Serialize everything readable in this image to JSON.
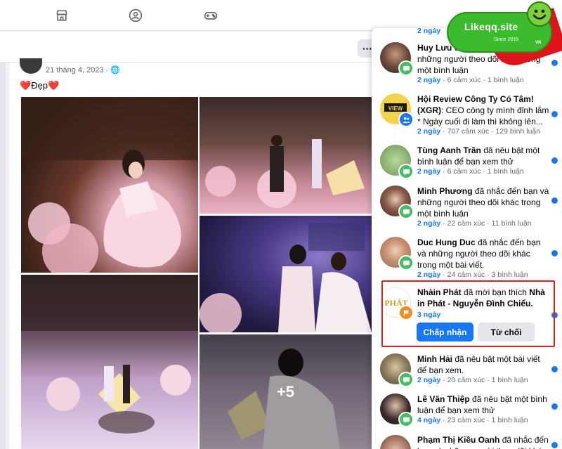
{
  "post": {
    "date": "21 tháng 4, 2023 ·",
    "caption_text": "Đẹp",
    "heart": "❤️",
    "more_label": "···",
    "more_photos": "+5"
  },
  "notifications": [
    {
      "text_tail": "2 ngày",
      "partial": true
    },
    {
      "name": "Huy Lưu",
      "action": "đã nhắc đến bạn và những người theo dõi khác trong một bình luận",
      "time": "2 ngày",
      "stats": "6 cảm xúc · 1 bình luận",
      "badge": "comment"
    },
    {
      "name": "Hội Review Công Ty Có Tâm! (XGR)",
      "action": ": CEO công ty mình đỉnh lắm * Ngày cuối đi làm thì không lên...",
      "time": "2 ngày",
      "stats": "707 cảm xúc · 129 bình luận",
      "badge": "group"
    },
    {
      "name": "Tùng Aanh Trần",
      "action": "đã nêu bật một bình luận để bạn xem thử",
      "time": "2 ngày",
      "stats": "6 cảm xúc · 1 bình luận",
      "badge": "comment"
    },
    {
      "name": "Minh Phương",
      "action": "đã nhắc đến bạn và những người theo dõi khác trong một bình luận",
      "time": "2 ngày",
      "stats": "22 cảm xúc · 11 bình luận",
      "badge": "comment"
    },
    {
      "name": "Duc Hung Duc",
      "action": "đã nhắc đến bạn và những người theo dõi khác trong một bài viết.",
      "time": "2 ngày",
      "stats": "24 cảm xúc · 3 bình luận",
      "badge": "comment"
    },
    {
      "name": "Nhàin Phát",
      "action": "đã mời bạn thích",
      "target": "Nhà in Phát - Nguyễn Đình Chiểu.",
      "time": "3 ngày",
      "badge": "page",
      "accept": "Chấp nhận",
      "decline": "Từ chối"
    },
    {
      "name": "Minh Hải",
      "action": "đã nêu bật một bài viết để bạn xem.",
      "time": "2 ngày",
      "stats": "20 cảm xúc · 1 bình luận",
      "badge": "comment"
    },
    {
      "name": "Lê Văn Thiệp",
      "action": "đã nêu bật một bình luận để bạn xem thử",
      "time": "4 ngày",
      "stats": "23 cảm xúc · 1 bình luận",
      "badge": "comment"
    },
    {
      "name": "Phạm Thị Kiều Oanh",
      "action": "đã nhắc đến bạn và những người theo dõi khác trong",
      "badge": "comment",
      "partial": true
    }
  ],
  "watermark": {
    "brand": "Likeqq.site",
    "since": "Since 2015",
    "vn": "VN"
  },
  "colors": {
    "accent": "#1877f2",
    "badge_green": "#45bd62",
    "highlight": "#e0211b"
  }
}
